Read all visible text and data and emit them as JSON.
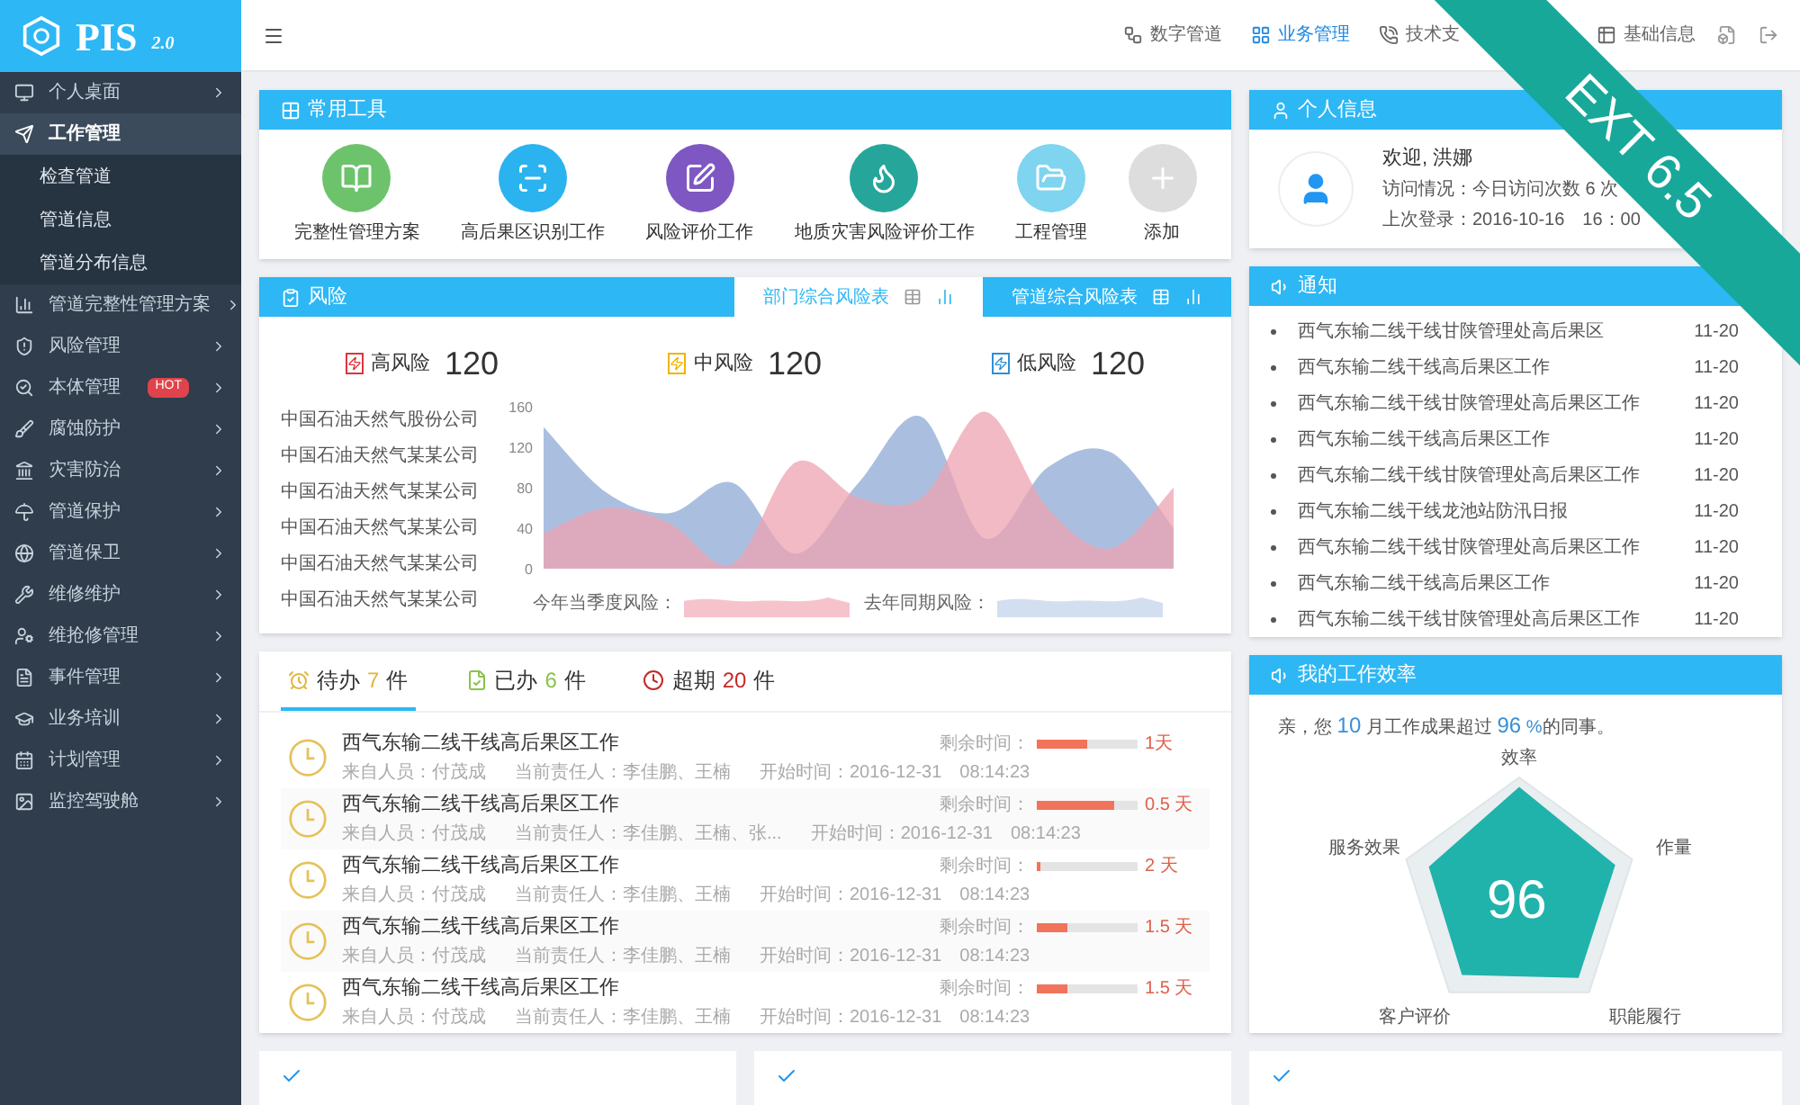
{
  "logo": {
    "name": "PIS",
    "version": "2.0"
  },
  "ribbon": {
    "label": "EXT 6.5"
  },
  "sidebar": {
    "items": [
      {
        "label": "个人桌面",
        "selected": false,
        "expanded": false
      },
      {
        "label": "工作管理",
        "selected": true,
        "expanded": true,
        "children": [
          {
            "label": "检查管道"
          },
          {
            "label": "管道信息"
          },
          {
            "label": "管道分布信息"
          }
        ]
      },
      {
        "label": "管道完整性管理方案",
        "selected": false,
        "expanded": false
      },
      {
        "label": "风险管理",
        "selected": false,
        "expanded": false
      },
      {
        "label": "本体管理",
        "selected": false,
        "expanded": false,
        "badge": "HOT"
      },
      {
        "label": "腐蚀防护",
        "selected": false,
        "expanded": false
      },
      {
        "label": "灾害防治",
        "selected": false,
        "expanded": false
      },
      {
        "label": "管道保护",
        "selected": false,
        "expanded": false
      },
      {
        "label": "管道保卫",
        "selected": false,
        "expanded": false
      },
      {
        "label": "维修维护",
        "selected": false,
        "expanded": false
      },
      {
        "label": "维抢修管理",
        "selected": false,
        "expanded": false
      },
      {
        "label": "事件管理",
        "selected": false,
        "expanded": false
      },
      {
        "label": "业务培训",
        "selected": false,
        "expanded": false
      },
      {
        "label": "计划管理",
        "selected": false,
        "expanded": false
      },
      {
        "label": "监控驾驶舱",
        "selected": false,
        "expanded": false
      }
    ]
  },
  "topbar": {
    "nav": [
      {
        "label": "数字管道",
        "selected": false
      },
      {
        "label": "业务管理",
        "selected": true
      },
      {
        "label": "技术支",
        "selected": false
      },
      {
        "label": "基础信息",
        "selected": false
      }
    ]
  },
  "tools": {
    "title": "常用工具",
    "items": [
      {
        "label": "完整性管理方案",
        "color": "#6cc36b"
      },
      {
        "label": "高后果区识别工作",
        "color": "#2bb3f0"
      },
      {
        "label": "风险评价工作",
        "color": "#7e57c2"
      },
      {
        "label": "地质灾害风险评价工作",
        "color": "#26a69a"
      },
      {
        "label": "工程管理",
        "color": "#7fd4ef"
      },
      {
        "label": "添加",
        "color": "#dddddd"
      }
    ]
  },
  "profile": {
    "title": "个人信息",
    "greeting": "欢迎, 洪娜",
    "visits": "访问情况：今日访问次数 6 次",
    "last_login": "上次登录：2016-10-16　16：00"
  },
  "risk": {
    "title": "风险",
    "tabs": [
      {
        "label": "部门综合风险表",
        "selected": true
      },
      {
        "label": "管道综合风险表",
        "selected": false
      }
    ],
    "levels": [
      {
        "label": "高风险",
        "value": "120",
        "color": "#d9363e"
      },
      {
        "label": "中风险",
        "value": "120",
        "color": "#f0b400"
      },
      {
        "label": "低风险",
        "value": "120",
        "color": "#2f8fd8"
      }
    ],
    "companies": [
      "中国石油天然气股份公司",
      "中国石油天然气某某公司",
      "中国石油天然气某某公司",
      "中国石油天然气某某公司",
      "中国石油天然气某某公司",
      "中国石油天然气某某公司"
    ],
    "chart_data": {
      "type": "area",
      "ylim": [
        0,
        160
      ],
      "yticks": [
        0,
        40,
        80,
        120,
        160
      ],
      "series": [
        {
          "color": "#8eaad6",
          "values": [
            140,
            75,
            55,
            85,
            15,
            85,
            150,
            30,
            100,
            115,
            40
          ]
        },
        {
          "color": "#eea3b1",
          "values": [
            35,
            60,
            45,
            5,
            105,
            70,
            70,
            155,
            60,
            20,
            80
          ]
        }
      ]
    },
    "sparklines": [
      {
        "label": "今年当季度风险：",
        "color": "#f6c3cc"
      },
      {
        "label": "去年同期风险：",
        "color": "#d3def0"
      }
    ]
  },
  "notices": {
    "title": "通知",
    "items": [
      {
        "text": "西气东输二线干线甘陕管理处高后果区",
        "date": "11-20"
      },
      {
        "text": "西气东输二线干线高后果区工作",
        "date": "11-20"
      },
      {
        "text": "西气东输二线干线甘陕管理处高后果区工作",
        "date": "11-20"
      },
      {
        "text": "西气东输二线干线高后果区工作",
        "date": "11-20"
      },
      {
        "text": "西气东输二线干线甘陕管理处高后果区工作",
        "date": "11-20"
      },
      {
        "text": "西气东输二线干线龙池站防汛日报",
        "date": "11-20"
      },
      {
        "text": "西气东输二线干线甘陕管理处高后果区工作",
        "date": "11-20"
      },
      {
        "text": "西气东输二线干线高后果区工作",
        "date": "11-20"
      },
      {
        "text": "西气东输二线干线甘陕管理处高后果区工作",
        "date": "11-20"
      }
    ]
  },
  "tasks": {
    "tabs": [
      {
        "label": "待办",
        "count": "7",
        "unit": "件",
        "color": "#e0b53a",
        "selected": true
      },
      {
        "label": "已办",
        "count": "6",
        "unit": "件",
        "color": "#8bc34a",
        "selected": false
      },
      {
        "label": "超期",
        "count": "20",
        "unit": "件",
        "color": "#c62828",
        "selected": false
      }
    ],
    "rows": [
      {
        "title": "西气东输二线干线高后果区工作",
        "from": "来自人员：付茂成",
        "owner": "当前责任人：李佳鹏、王楠",
        "start": "开始时间：2016-12-31　08:14:23",
        "remaining_label": "剩余时间：",
        "level": 0.5,
        "remaining": "1天"
      },
      {
        "title": "西气东输二线干线高后果区工作",
        "from": "来自人员：付茂成",
        "owner": "当前责任人：李佳鹏、王楠、张...",
        "start": "开始时间：2016-12-31　08:14:23",
        "remaining_label": "剩余时间：",
        "level": 0.77,
        "remaining": "0.5 天"
      },
      {
        "title": "西气东输二线干线高后果区工作",
        "from": "来自人员：付茂成",
        "owner": "当前责任人：李佳鹏、王楠",
        "start": "开始时间：2016-12-31　08:14:23",
        "remaining_label": "剩余时间：",
        "level": 0.03,
        "remaining": "2 天"
      },
      {
        "title": "西气东输二线干线高后果区工作",
        "from": "来自人员：付茂成",
        "owner": "当前责任人：李佳鹏、王楠",
        "start": "开始时间：2016-12-31　08:14:23",
        "remaining_label": "剩余时间：",
        "level": 0.3,
        "remaining": "1.5 天"
      },
      {
        "title": "西气东输二线干线高后果区工作",
        "from": "来自人员：付茂成",
        "owner": "当前责任人：李佳鹏、王楠",
        "start": "开始时间：2016-12-31　08:14:23",
        "remaining_label": "剩余时间：",
        "level": 0.3,
        "remaining": "1.5 天"
      }
    ]
  },
  "efficiency": {
    "title": "我的工作效率",
    "sentence": {
      "prefix": "亲，您",
      "month": "10",
      "middle": "月工作成果超过",
      "percent": "96",
      "unit": "%",
      "suffix": "的同事。"
    },
    "score": "96",
    "axes": [
      "效率",
      "作量",
      "职能履行",
      "客户评价",
      "服务效果"
    ]
  }
}
